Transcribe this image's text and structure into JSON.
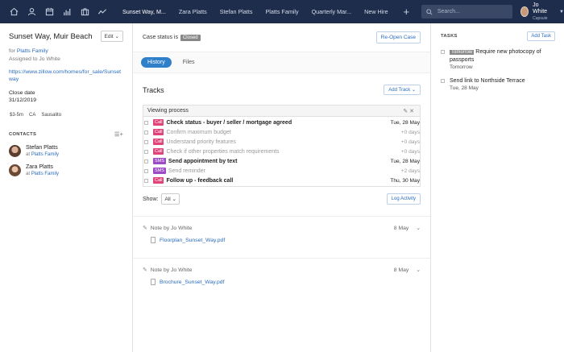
{
  "nav": {
    "tabs": [
      "Sunset Way, M...",
      "Zara Platts",
      "Stefan Platts",
      "Platts Family",
      "Quarterly Mar...",
      "New Hire"
    ],
    "search_placeholder": "Search...",
    "user_name": "Jo White",
    "user_sub": "Capsule"
  },
  "case": {
    "title": "Sunset Way, Muir Beach",
    "edit_label": "Edit",
    "for_prefix": "for",
    "for_link": "Platts Family",
    "assigned": "Assigned to Jo White",
    "url": "https://www.zillow.com/homes/for_sale/Sunset way",
    "close_label": "Close date",
    "close_date": "31/12/2019",
    "tags": [
      "$3-5m",
      "CA",
      "Sausalito"
    ]
  },
  "contacts": {
    "heading": "CONTACTS",
    "items": [
      {
        "name": "Stefan Platts",
        "at": "at",
        "org": "Platts Family"
      },
      {
        "name": "Zara Platts",
        "at": "at",
        "org": "Platts Family"
      }
    ]
  },
  "main": {
    "status_label": "Case status is",
    "status_value": "Closed",
    "reopen_label": "Re-Open Case",
    "tabs": [
      "History",
      "Files"
    ],
    "tracks_title": "Tracks",
    "add_track_label": "Add Track",
    "process_name": "Viewing process",
    "tasks": [
      {
        "type": "Call",
        "text": "Check status - buyer / seller / mortgage agreed",
        "date": "Tue, 28 May",
        "style": "bold"
      },
      {
        "type": "Call",
        "text": "Confirm maximum budget",
        "date": "+0 days",
        "style": "muted"
      },
      {
        "type": "Call",
        "text": "Understand priority features",
        "date": "+0 days",
        "style": "muted"
      },
      {
        "type": "Call",
        "text": "Check if other properties match requirements",
        "date": "+0 days",
        "style": "muted"
      },
      {
        "type": "SMS",
        "text": "Send appointment by text",
        "date": "Tue, 28 May",
        "style": "bold"
      },
      {
        "type": "SMS",
        "text": "Send reminder",
        "date": "+2 days",
        "style": "muted"
      },
      {
        "type": "Call",
        "text": "Follow up - feedback call",
        "date": "Thu, 30 May",
        "style": "bold"
      }
    ],
    "show_label": "Show:",
    "show_value": "All",
    "log_activity_label": "Log Activity",
    "notes": [
      {
        "author": "Note by Jo White",
        "date": "8 May",
        "file": "Floorplan_Sunset_Way.pdf"
      },
      {
        "author": "Note by Jo White",
        "date": "8 May",
        "file": "Brochure_Sunset_Way.pdf"
      }
    ]
  },
  "tasks_panel": {
    "heading": "TASKS",
    "add_label": "Add Task",
    "items": [
      {
        "badge": "Tomorrow",
        "title": "Require new photocopy of passports",
        "sub": "Tomorrow"
      },
      {
        "badge": "",
        "title": "Send link to Northside Terrace",
        "sub": "Tue, 28 May"
      }
    ]
  }
}
